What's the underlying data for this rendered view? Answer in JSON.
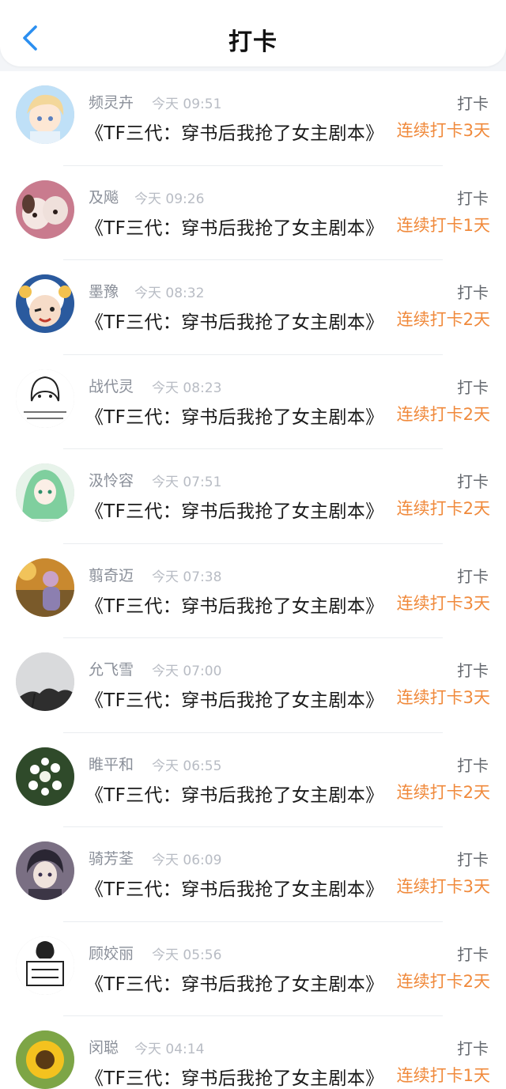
{
  "header": {
    "title": "打卡",
    "back_icon": "chevron-left-icon",
    "accent": "#2b8ff0"
  },
  "colors": {
    "streak": "#f08a3c",
    "name": "#8a8f99",
    "time": "#b8bcc4"
  },
  "items": [
    {
      "name": "频灵卉",
      "time": "今天 09:51",
      "type": "打卡",
      "book": "《TF三代：穿书后我抢了女主剧本》",
      "streak": "连续打卡3天",
      "avatar": "anime-boy-avatar"
    },
    {
      "name": "及飚",
      "time": "今天 09:26",
      "type": "打卡",
      "book": "《TF三代：穿书后我抢了女主剧本》",
      "streak": "连续打卡1天",
      "avatar": "puppy-avatar"
    },
    {
      "name": "墨豫",
      "time": "今天 08:32",
      "type": "打卡",
      "book": "《TF三代：穿书后我抢了女主剧本》",
      "streak": "连续打卡2天",
      "avatar": "cartoon-sheep-avatar"
    },
    {
      "name": "战代灵",
      "time": "今天 08:23",
      "type": "打卡",
      "book": "《TF三代：穿书后我抢了女主剧本》",
      "streak": "连续打卡2天",
      "avatar": "sketch-girl-avatar"
    },
    {
      "name": "汲怜容",
      "time": "今天 07:51",
      "type": "打卡",
      "book": "《TF三代：穿书后我抢了女主剧本》",
      "streak": "连续打卡2天",
      "avatar": "green-hair-avatar"
    },
    {
      "name": "翦奇迈",
      "time": "今天 07:38",
      "type": "打卡",
      "book": "《TF三代：穿书后我抢了女主剧本》",
      "streak": "连续打卡3天",
      "avatar": "autumn-girl-avatar"
    },
    {
      "name": "允飞雪",
      "time": "今天 07:00",
      "type": "打卡",
      "book": "《TF三代：穿书后我抢了女主剧本》",
      "streak": "连续打卡3天",
      "avatar": "tree-sky-avatar"
    },
    {
      "name": "睢平和",
      "time": "今天 06:55",
      "type": "打卡",
      "book": "《TF三代：穿书后我抢了女主剧本》",
      "streak": "连续打卡2天",
      "avatar": "white-flowers-avatar"
    },
    {
      "name": "骑芳荃",
      "time": "今天 06:09",
      "type": "打卡",
      "book": "《TF三代：穿书后我抢了女主剧本》",
      "streak": "连续打卡3天",
      "avatar": "anime-dark-boy-avatar"
    },
    {
      "name": "顾姣丽",
      "time": "今天 05:56",
      "type": "打卡",
      "book": "《TF三代：穿书后我抢了女主剧本》",
      "streak": "连续打卡2天",
      "avatar": "sketch-sign-avatar"
    },
    {
      "name": "闵聪",
      "time": "今天 04:14",
      "type": "打卡",
      "book": "《TF三代：穿书后我抢了女主剧本》",
      "streak": "连续打卡1天",
      "avatar": "sunflower-avatar"
    }
  ]
}
